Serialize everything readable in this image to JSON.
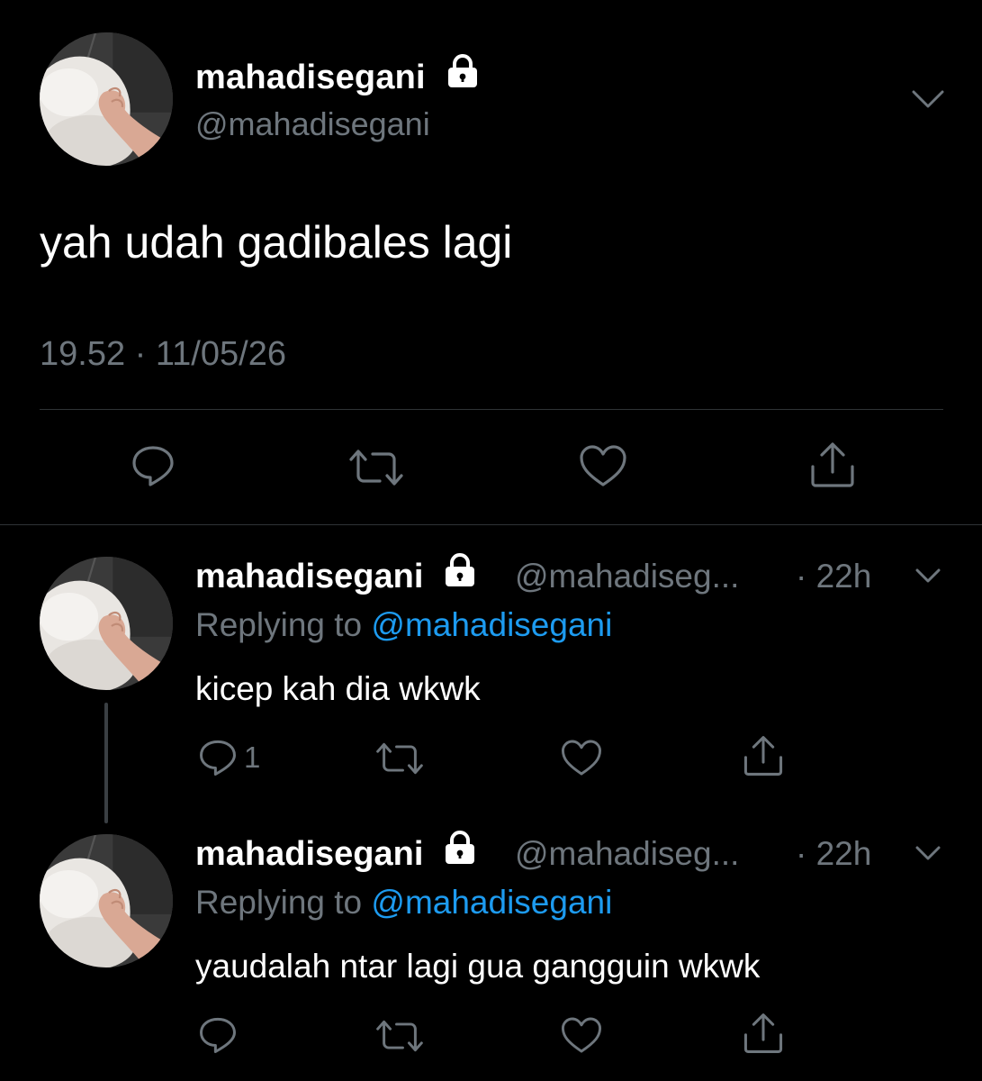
{
  "main_tweet": {
    "display_name": "mahadisegani",
    "handle": "@mahadisegani",
    "text": "yah udah gadibales lagi",
    "timestamp": "19.52 · 11/05/26",
    "icons": [
      "lock-icon",
      "chevron-down-icon",
      "reply-icon",
      "retweet-icon",
      "like-icon",
      "share-icon"
    ]
  },
  "replies": [
    {
      "display_name": "mahadisegani",
      "handle": "@mahadiseg...",
      "time": "· 22h",
      "replying_prefix": "Replying to ",
      "replying_to": "@mahadisegani",
      "text": "kicep kah dia wkwk",
      "reply_count": "1"
    },
    {
      "display_name": "mahadisegani",
      "handle": "@mahadiseg...",
      "time": "· 22h",
      "replying_prefix": "Replying to ",
      "replying_to": "@mahadisegani",
      "text": "yaudalah ntar lagi gua gangguin wkwk",
      "reply_count": ""
    }
  ],
  "colors": {
    "background": "#000000",
    "primary_text": "#ffffff",
    "secondary_text": "#6e767d",
    "link": "#1d9bf0",
    "divider": "#2f3336"
  }
}
